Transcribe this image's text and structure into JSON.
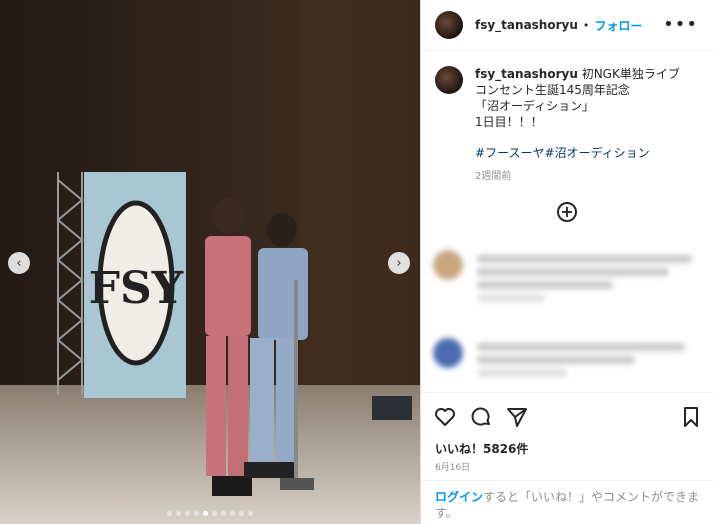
{
  "post": {
    "username": "fsy_tanashoryu",
    "separator": "•",
    "follow_label": "フォロー",
    "more_label": "•••"
  },
  "caption": {
    "username": "fsy_tanashoryu",
    "text": "初NGK単独ライブ\nコンセント生誕145周年記念\n「沼オーディション」\n1日目！！！",
    "hashtags": "#フースーヤ#沼オーディション",
    "time_ago": "2週間前"
  },
  "stage_logo": "FSY",
  "likes": "いいね！5826件",
  "date": "6月16日",
  "login": {
    "link": "ログイン",
    "rest": "すると「いいね！」やコメントができます。"
  },
  "colors": {
    "accent": "#0095f6",
    "hashtag": "#00376b",
    "muted": "#8e8e8e"
  },
  "icons": [
    "heart-icon",
    "comment-icon",
    "share-icon",
    "bookmark-icon",
    "add-comment-icon",
    "chevron-left-icon",
    "chevron-right-icon"
  ]
}
